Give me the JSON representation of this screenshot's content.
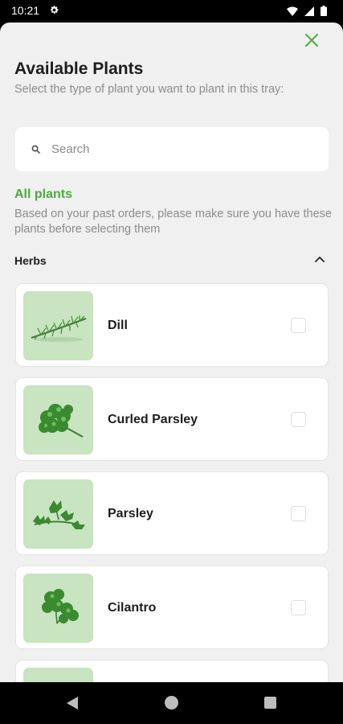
{
  "status": {
    "time": "10:21"
  },
  "header": {
    "title": "Available Plants",
    "subtitle": "Select the type of plant you want to plant in this tray:"
  },
  "search": {
    "placeholder": "Search",
    "value": ""
  },
  "filter": {
    "label": "All plants",
    "note": "Based on your past orders, please make sure you have these plants before selecting them"
  },
  "section": {
    "title": "Herbs",
    "expanded": true
  },
  "plants": [
    {
      "name": "Dill",
      "checked": false,
      "icon": "dill-image"
    },
    {
      "name": "Curled Parsley",
      "checked": false,
      "icon": "curled-parsley-image"
    },
    {
      "name": "Parsley",
      "checked": false,
      "icon": "parsley-image"
    },
    {
      "name": "Cilantro",
      "checked": false,
      "icon": "cilantro-image"
    }
  ],
  "colors": {
    "accent": "#4eaa3f",
    "thumb_bg": "#c8e4c0",
    "sheet_bg": "#f0f0f1"
  }
}
